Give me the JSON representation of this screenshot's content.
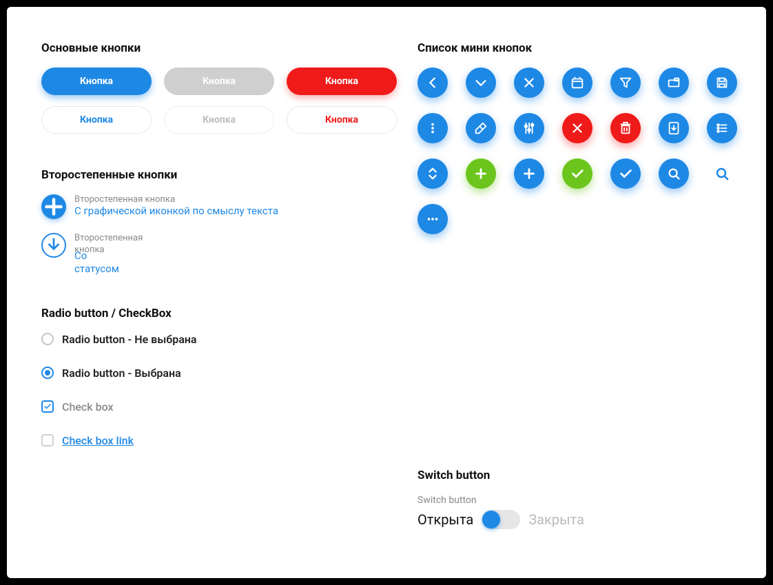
{
  "left": {
    "main_hdr": "Основные кнопки",
    "buttons": {
      "r1": [
        "Кнопка",
        "Кнопка",
        "Кнопка"
      ],
      "r2": [
        "Кнопка",
        "Кнопка",
        "Кнопка"
      ]
    },
    "sec_hdr": "Второстепенные кнопки",
    "sec1_title": "Второстепенная кнопка",
    "sec1_sub": "С графической иконкой по смыслу текста",
    "sec2_title": "Второстепенная кнопка",
    "sec2_sub": "Со статусом",
    "form_hdr": "Radio button / CheckBox",
    "radio_off": "Radio button - Не выбрана",
    "radio_on": "Radio button - Выбрана",
    "cb": "Check box",
    "cb_link": "Check box link"
  },
  "right": {
    "mini_hdr": "Список мини кнопок",
    "switch_hdr": "Switch button",
    "switch_lbl": "Switch button",
    "switch_on": "Открыта",
    "switch_off": "Закрыта"
  },
  "colors": {
    "blue": "#1e88e5",
    "red": "#ef1a1a",
    "green": "#6cc51d"
  },
  "mini_icons": [
    "chevron-left",
    "chevron-down",
    "close",
    "calendar",
    "filter",
    "folder",
    "save",
    "dots-vertical",
    "eraser",
    "sliders",
    "close-red",
    "trash",
    "download",
    "list",
    "chevrons-ud",
    "plus-green",
    "plus-blue",
    "check-green",
    "check-blue",
    "search",
    "search-ghost",
    "dots-horizontal"
  ]
}
